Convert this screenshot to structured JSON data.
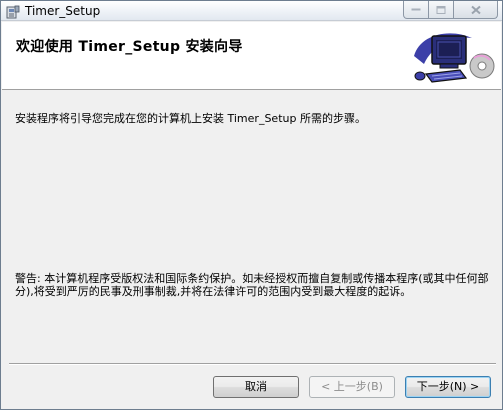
{
  "window": {
    "title": "Timer_Setup",
    "icons": {
      "app": "installer-icon",
      "minimize": "minimize-icon",
      "maximize": "maximize-icon",
      "close": "close-icon"
    }
  },
  "header": {
    "title": "欢迎使用 Timer_Setup 安装向导",
    "art_icon": "computer-setup-icon"
  },
  "body": {
    "intro": "安装程序将引导您完成在您的计算机上安装 Timer_Setup 所需的步骤。",
    "warning": "警告: 本计算机程序受版权法和国际条约保护。如未经授权而擅自复制或传播本程序(或其中任何部分),将受到严厉的民事及刑事制裁,并将在法律许可的范围内受到最大程度的起诉。"
  },
  "buttons": {
    "cancel": "取消",
    "back": "< 上一步(B)",
    "next": "下一步(N) >"
  },
  "colors": {
    "window_bg": "#f0f0f0",
    "header_bg": "#ffffff",
    "next_button_border": "#3c7fb1"
  }
}
